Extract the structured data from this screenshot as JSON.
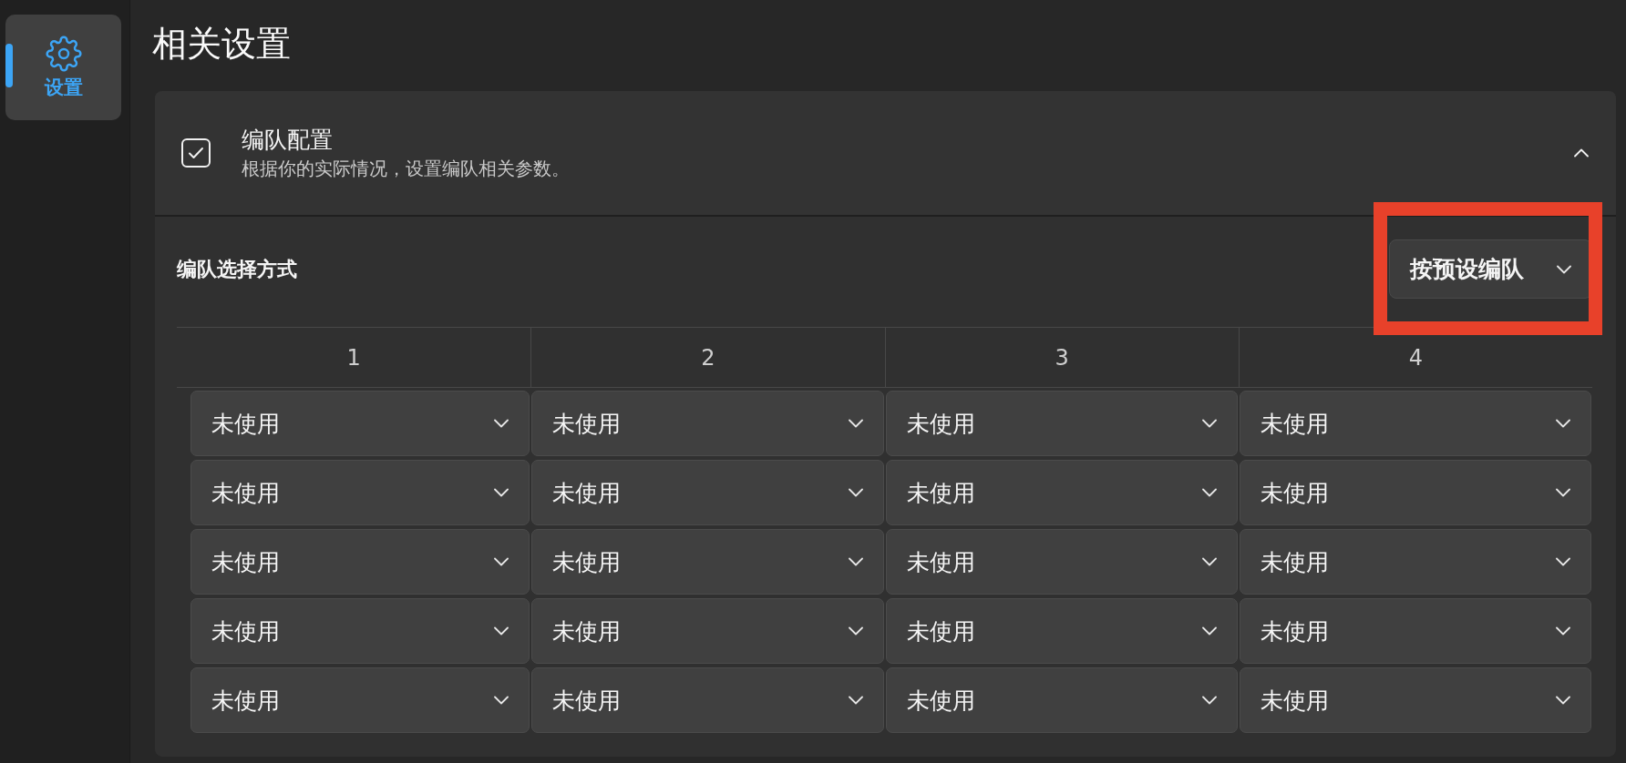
{
  "sidebar": {
    "items": [
      {
        "label": "设置",
        "selected": true
      }
    ]
  },
  "page": {
    "title": "相关设置"
  },
  "section": {
    "title": "编队配置",
    "subtitle": "根据你的实际情况，设置编队相关参数。",
    "expanded": true,
    "selector": {
      "label": "编队选择方式",
      "value": "按预设编队",
      "highlighted": true
    },
    "table": {
      "columns": [
        "1",
        "2",
        "3",
        "4"
      ],
      "rows": [
        [
          "未使用",
          "未使用",
          "未使用",
          "未使用"
        ],
        [
          "未使用",
          "未使用",
          "未使用",
          "未使用"
        ],
        [
          "未使用",
          "未使用",
          "未使用",
          "未使用"
        ],
        [
          "未使用",
          "未使用",
          "未使用",
          "未使用"
        ],
        [
          "未使用",
          "未使用",
          "未使用",
          "未使用"
        ]
      ]
    }
  }
}
